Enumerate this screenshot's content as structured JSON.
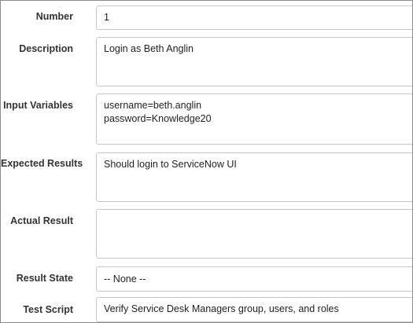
{
  "form": {
    "number": {
      "label": "Number",
      "value": "1"
    },
    "description": {
      "label": "Description",
      "value": "Login as Beth Anglin"
    },
    "input_variables": {
      "label": "Input Variables",
      "value": "username=beth.anglin\npassword=Knowledge20"
    },
    "expected_results": {
      "label": "Expected Results",
      "value": "Should login to ServiceNow UI"
    },
    "actual_result": {
      "label": "Actual Result",
      "value": ""
    },
    "result_state": {
      "label": "Result State",
      "value": "-- None --"
    },
    "test_script": {
      "label": "Test Script",
      "value": "Verify Service Desk Managers group, users, and roles"
    }
  }
}
